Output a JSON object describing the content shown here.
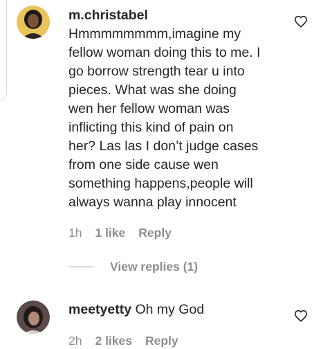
{
  "comments": [
    {
      "username": "m.christabel",
      "lines": [
        "Hmmmmmmmm,imagine my",
        "fellow woman doing this to me. I",
        "go borrow strength tear u into",
        "pieces. What was she doing",
        "wen her fellow woman was",
        "inflicting this kind of pain on",
        "her? Las las I don’t judge cases",
        "from one side cause wen",
        "something happens,people will",
        "always wanna play innocent"
      ],
      "time": "1h",
      "likes": "1 like",
      "reply_label": "Reply",
      "view_replies": "View replies (1)"
    },
    {
      "username": "meetyetty",
      "text": "Oh my God",
      "time": "2h",
      "likes": "2 likes",
      "reply_label": "Reply"
    }
  ],
  "icons": {
    "like": "heart-outline-icon"
  },
  "colors": {
    "text": "#262626",
    "secondary": "#8e8e8e",
    "avatar1_bg": "#e8c45a",
    "avatar2_bg": "#5a4a4a"
  }
}
